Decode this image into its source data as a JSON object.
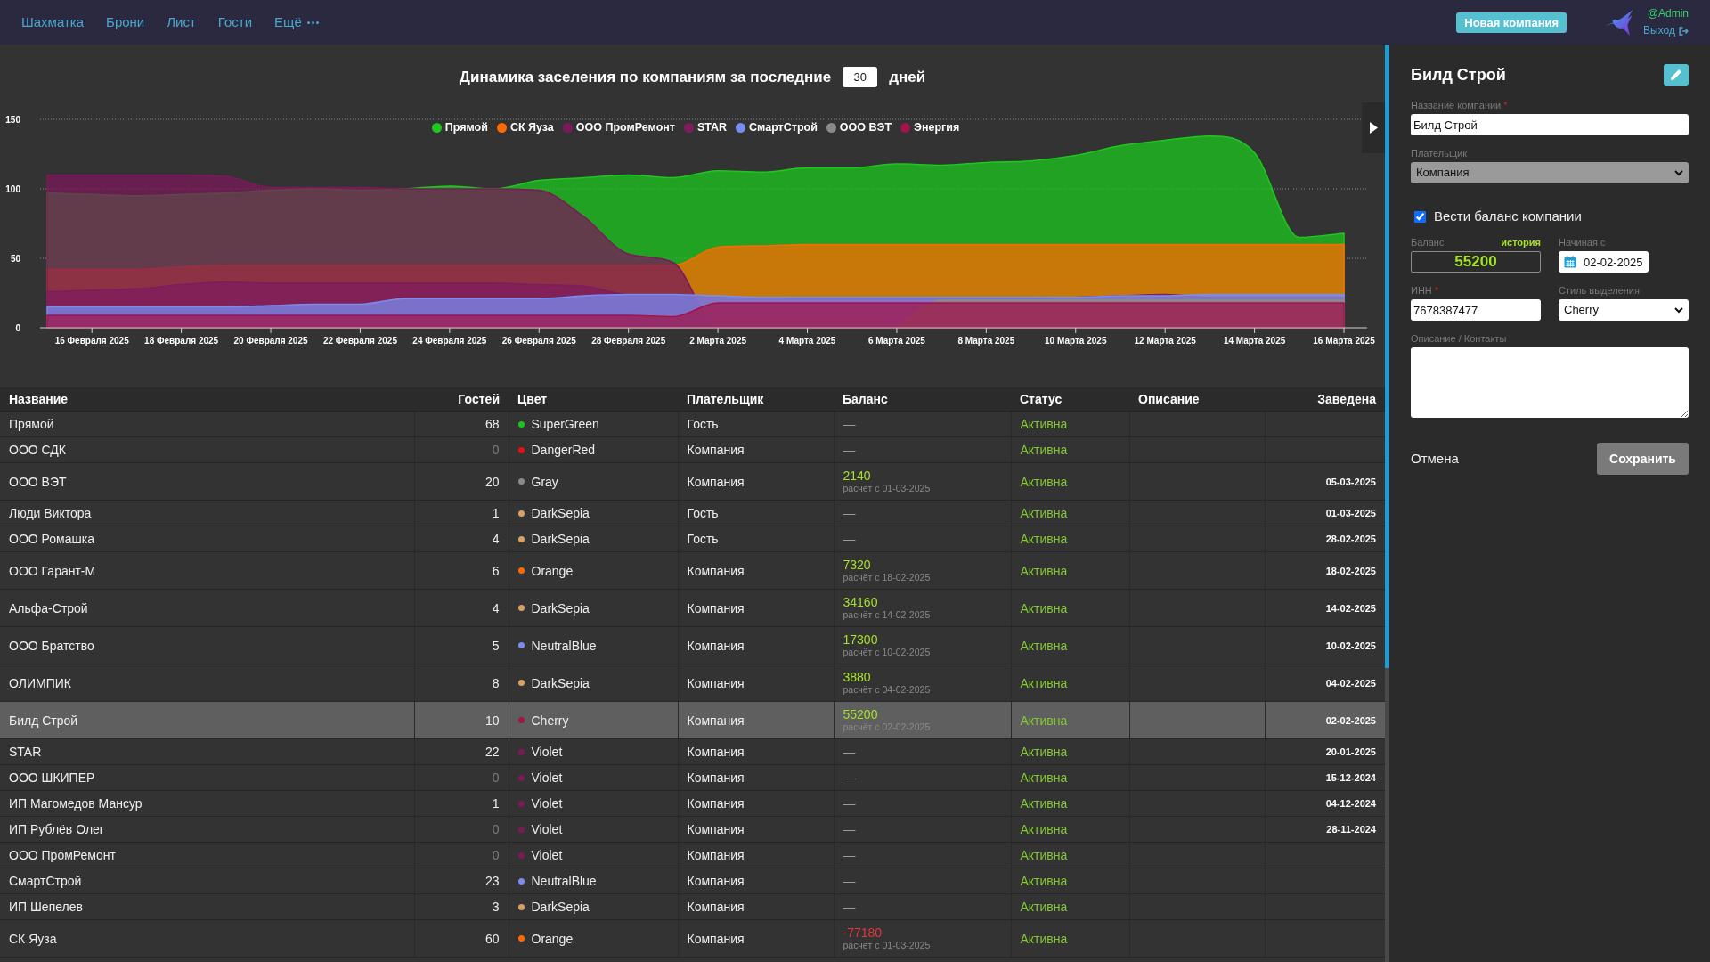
{
  "navbar": {
    "links": [
      {
        "label": "Шахматка",
        "kind": "link"
      },
      {
        "label": "Брони",
        "kind": "link"
      },
      {
        "label": "Лист",
        "kind": "link"
      },
      {
        "label": "Гости",
        "kind": "link"
      },
      {
        "label": "Ещё",
        "kind": "menu"
      }
    ],
    "new_company_button": "Новая компания",
    "user": "@Admin",
    "logout": "Выход"
  },
  "occupancy": {
    "title": "Динамика заселения по компаниям за последние",
    "days": "30",
    "days_unit": "дней",
    "chart_data": {
      "type": "area",
      "stacked": false,
      "legend": "top",
      "categories": [
        null,
        "16 Февраля 2025",
        null,
        "18 Февраля 2025",
        null,
        "20 Февраля 2025",
        null,
        "22 Февраля 2025",
        null,
        "24 Февраля 2025",
        null,
        "26 Февраля 2025",
        null,
        "28 Февраля 2025",
        null,
        "2 Марта 2025",
        null,
        "4 Марта 2025",
        null,
        "6 Марта 2025",
        null,
        "8 Марта 2025",
        null,
        "10 Марта 2025",
        null,
        "12 Марта 2025",
        null,
        "14 Марта 2025",
        null,
        "16 Марта 2025"
      ],
      "ylim": [
        0,
        150
      ],
      "yticks": [
        {
          "value": 0,
          "label": "0"
        },
        {
          "value": 50,
          "label": "50"
        },
        {
          "value": 100,
          "label": "100"
        },
        {
          "value": 150,
          "label": "150"
        }
      ],
      "series": [
        {
          "name": "Прямой",
          "color": "#1ec81e",
          "values": [
            97,
            96,
            95,
            96,
            97,
            99,
            100,
            99,
            100,
            102,
            100,
            106,
            108,
            110,
            108,
            113,
            112,
            115,
            115,
            118,
            117,
            119,
            120,
            124,
            131,
            135,
            138,
            126,
            65,
            68
          ]
        },
        {
          "name": "СК Яуза",
          "color": "#ff6a00",
          "values": [
            42,
            42,
            42,
            44,
            45,
            45,
            45,
            45,
            45,
            45,
            45,
            45,
            45,
            45,
            45,
            58,
            59,
            60,
            60,
            60,
            60,
            60,
            60,
            60,
            60,
            60,
            60,
            60,
            60,
            60
          ]
        },
        {
          "name": "ООО ПромРемонт",
          "color": "#7a1a5a",
          "values": [
            110,
            110,
            110,
            110,
            109,
            101,
            101,
            101,
            100,
            100,
            100,
            99,
            80,
            53,
            47,
            0,
            0,
            0,
            0,
            0,
            0,
            0,
            0,
            0,
            0,
            0,
            0,
            0,
            0,
            0
          ]
        },
        {
          "name": "STAR",
          "color": "#7e1c5e",
          "values": [
            26,
            27,
            28,
            31,
            33,
            32,
            32,
            32,
            32,
            32,
            32,
            31,
            30,
            24,
            24,
            22,
            22,
            21,
            21,
            21,
            21,
            21,
            21,
            22,
            23,
            24,
            22,
            22,
            22,
            22
          ]
        },
        {
          "name": "СмартСтрой",
          "color": "#7b8cf0",
          "values": [
            15,
            15,
            15,
            15,
            15,
            16,
            17,
            17,
            21,
            21,
            21,
            21,
            23,
            24,
            24,
            23,
            22,
            22,
            22,
            22,
            22,
            22,
            22,
            22,
            23,
            23,
            24,
            24,
            24,
            24
          ]
        },
        {
          "name": "ООО ВЭТ",
          "color": "#8a8a8a",
          "values": [
            null,
            null,
            null,
            null,
            null,
            null,
            null,
            null,
            null,
            null,
            null,
            null,
            null,
            null,
            null,
            null,
            null,
            null,
            null,
            0,
            20,
            20,
            20,
            20,
            20,
            20,
            20,
            20,
            20,
            20
          ]
        },
        {
          "name": "Энергия",
          "color": "#a0154a",
          "values": [
            9,
            9,
            9,
            9,
            9,
            9,
            9,
            9,
            9,
            9,
            9,
            9,
            9,
            9,
            8,
            18,
            18,
            18,
            18,
            18,
            18,
            18,
            18,
            18,
            18,
            18,
            18,
            18,
            18,
            18
          ]
        }
      ]
    }
  },
  "table": {
    "columns": [
      "Название",
      "Гостей",
      "Цвет",
      "Плательщик",
      "Баланс",
      "Статус",
      "Описание",
      "Заведена"
    ],
    "rows": [
      {
        "name": "Прямой",
        "guests": "68",
        "guests_dimmed": false,
        "color": "#17c817",
        "color_name": "SuperGreen",
        "payer": "Гость",
        "balance": {
          "kind": "none",
          "text": "—"
        },
        "status": "Активна",
        "selected": false
      },
      {
        "name": "ООО СДК",
        "guests": "0",
        "guests_dimmed": true,
        "color": "#e81010",
        "color_name": "DangerRed",
        "payer": "Компания",
        "balance": {
          "kind": "none",
          "text": "—"
        },
        "status": "Активна",
        "selected": false
      },
      {
        "name": "ООО ВЭТ",
        "guests": "20",
        "guests_dimmed": false,
        "color": "#8a8a8a",
        "color_name": "Gray",
        "payer": "Компания",
        "balance": {
          "kind": "account",
          "amount": "2140",
          "note": "расчёт с 01-03-2025",
          "negative": false
        },
        "status": "Активна",
        "created": "05-03-2025",
        "selected": false
      },
      {
        "name": "Люди Виктора",
        "guests": "1",
        "guests_dimmed": false,
        "color": "#d6a164",
        "color_name": "DarkSepia",
        "payer": "Гость",
        "balance": {
          "kind": "none",
          "text": "—"
        },
        "status": "Активна",
        "created": "01-03-2025",
        "selected": false
      },
      {
        "name": "ООО Ромашка",
        "guests": "4",
        "guests_dimmed": false,
        "color": "#d6a164",
        "color_name": "DarkSepia",
        "payer": "Гость",
        "balance": {
          "kind": "none",
          "text": "—"
        },
        "status": "Активна",
        "created": "28-02-2025",
        "selected": false
      },
      {
        "name": "ООО Гарант-М",
        "guests": "6",
        "guests_dimmed": false,
        "color": "#ff6a00",
        "color_name": "Orange",
        "payer": "Компания",
        "balance": {
          "kind": "account",
          "amount": "7320",
          "note": "расчёт с 18-02-2025",
          "negative": false
        },
        "status": "Активна",
        "created": "18-02-2025",
        "selected": false
      },
      {
        "name": "Альфа-Строй",
        "guests": "4",
        "guests_dimmed": false,
        "color": "#d6a164",
        "color_name": "DarkSepia",
        "payer": "Компания",
        "balance": {
          "kind": "account",
          "amount": "34160",
          "note": "расчёт с 14-02-2025",
          "negative": false
        },
        "status": "Активна",
        "created": "14-02-2025",
        "selected": false
      },
      {
        "name": "ООО Братство",
        "guests": "5",
        "guests_dimmed": false,
        "color": "#7b8cf0",
        "color_name": "NeutralBlue",
        "payer": "Компания",
        "balance": {
          "kind": "account",
          "amount": "17300",
          "note": "расчёт с 10-02-2025",
          "negative": false
        },
        "status": "Активна",
        "created": "10-02-2025",
        "selected": false
      },
      {
        "name": "ОЛИМПИК",
        "guests": "8",
        "guests_dimmed": false,
        "color": "#d6a164",
        "color_name": "DarkSepia",
        "payer": "Компания",
        "balance": {
          "kind": "account",
          "amount": "3880",
          "note": "расчёт с 04-02-2025",
          "negative": false
        },
        "status": "Активна",
        "created": "04-02-2025",
        "selected": false
      },
      {
        "name": "Билд Строй",
        "guests": "10",
        "guests_dimmed": false,
        "color": "#a0154a",
        "color_name": "Cherry",
        "payer": "Компания",
        "balance": {
          "kind": "account",
          "amount": "55200",
          "note": "расчёт с 02-02-2025",
          "negative": false
        },
        "status": "Активна",
        "created": "02-02-2025",
        "selected": true
      },
      {
        "name": "STAR",
        "guests": "22",
        "guests_dimmed": false,
        "color": "#7a1a5a",
        "color_name": "Violet",
        "payer": "Компания",
        "balance": {
          "kind": "none",
          "text": "—"
        },
        "status": "Активна",
        "created": "20-01-2025",
        "selected": false
      },
      {
        "name": "ООО ШКИПЕР",
        "guests": "0",
        "guests_dimmed": true,
        "color": "#7a1a5a",
        "color_name": "Violet",
        "payer": "Компания",
        "balance": {
          "kind": "none",
          "text": "—"
        },
        "status": "Активна",
        "created": "15-12-2024",
        "selected": false
      },
      {
        "name": "ИП Магомедов Мансур",
        "guests": "1",
        "guests_dimmed": false,
        "color": "#7a1a5a",
        "color_name": "Violet",
        "payer": "Компания",
        "balance": {
          "kind": "none",
          "text": "—"
        },
        "status": "Активна",
        "created": "04-12-2024",
        "selected": false
      },
      {
        "name": "ИП Рублёв Олег",
        "guests": "0",
        "guests_dimmed": true,
        "color": "#7a1a5a",
        "color_name": "Violet",
        "payer": "Компания",
        "balance": {
          "kind": "none",
          "text": "—"
        },
        "status": "Активна",
        "created": "28-11-2024",
        "selected": false
      },
      {
        "name": "ООО ПромРемонт",
        "guests": "0",
        "guests_dimmed": true,
        "color": "#7a1a5a",
        "color_name": "Violet",
        "payer": "Компания",
        "balance": {
          "kind": "none",
          "text": "—"
        },
        "status": "Активна",
        "selected": false
      },
      {
        "name": "СмартСтрой",
        "guests": "23",
        "guests_dimmed": false,
        "color": "#7b8cf0",
        "color_name": "NeutralBlue",
        "payer": "Компания",
        "balance": {
          "kind": "none",
          "text": "—"
        },
        "status": "Активна",
        "selected": false
      },
      {
        "name": "ИП Шепелев",
        "guests": "3",
        "guests_dimmed": false,
        "color": "#d6a164",
        "color_name": "DarkSepia",
        "payer": "Компания",
        "balance": {
          "kind": "none",
          "text": "—"
        },
        "status": "Активна",
        "selected": false
      },
      {
        "name": "СК Яуза",
        "guests": "60",
        "guests_dimmed": false,
        "color": "#ff6a00",
        "color_name": "Orange",
        "payer": "Компания",
        "balance": {
          "kind": "account",
          "amount": "-77180",
          "note": "расчёт с 01-03-2025",
          "negative": true
        },
        "status": "Активна",
        "selected": false
      }
    ]
  },
  "editor": {
    "title": "Билд Строй",
    "company_name": {
      "label": "Название компании",
      "required_mark": "*",
      "value": "Билд Строй"
    },
    "payer": {
      "label": "Плательщик",
      "value": "Компания",
      "disabled": true
    },
    "track_balance": {
      "label": "Вести баланс компании",
      "checked": true
    },
    "balance": {
      "label": "Баланс",
      "history_link": "история",
      "value": "55200"
    },
    "start_date": {
      "label": "Начиная с",
      "value": "02-02-2025"
    },
    "inn": {
      "label": "ИНН",
      "required_mark": "*",
      "value": "7678387477"
    },
    "highlight_style": {
      "label": "Стиль выделения",
      "value": "Cherry",
      "disabled": false
    },
    "description": {
      "label": "Описание / Контакты"
    },
    "cancel": "Отмена",
    "save": "Сохранить"
  }
}
